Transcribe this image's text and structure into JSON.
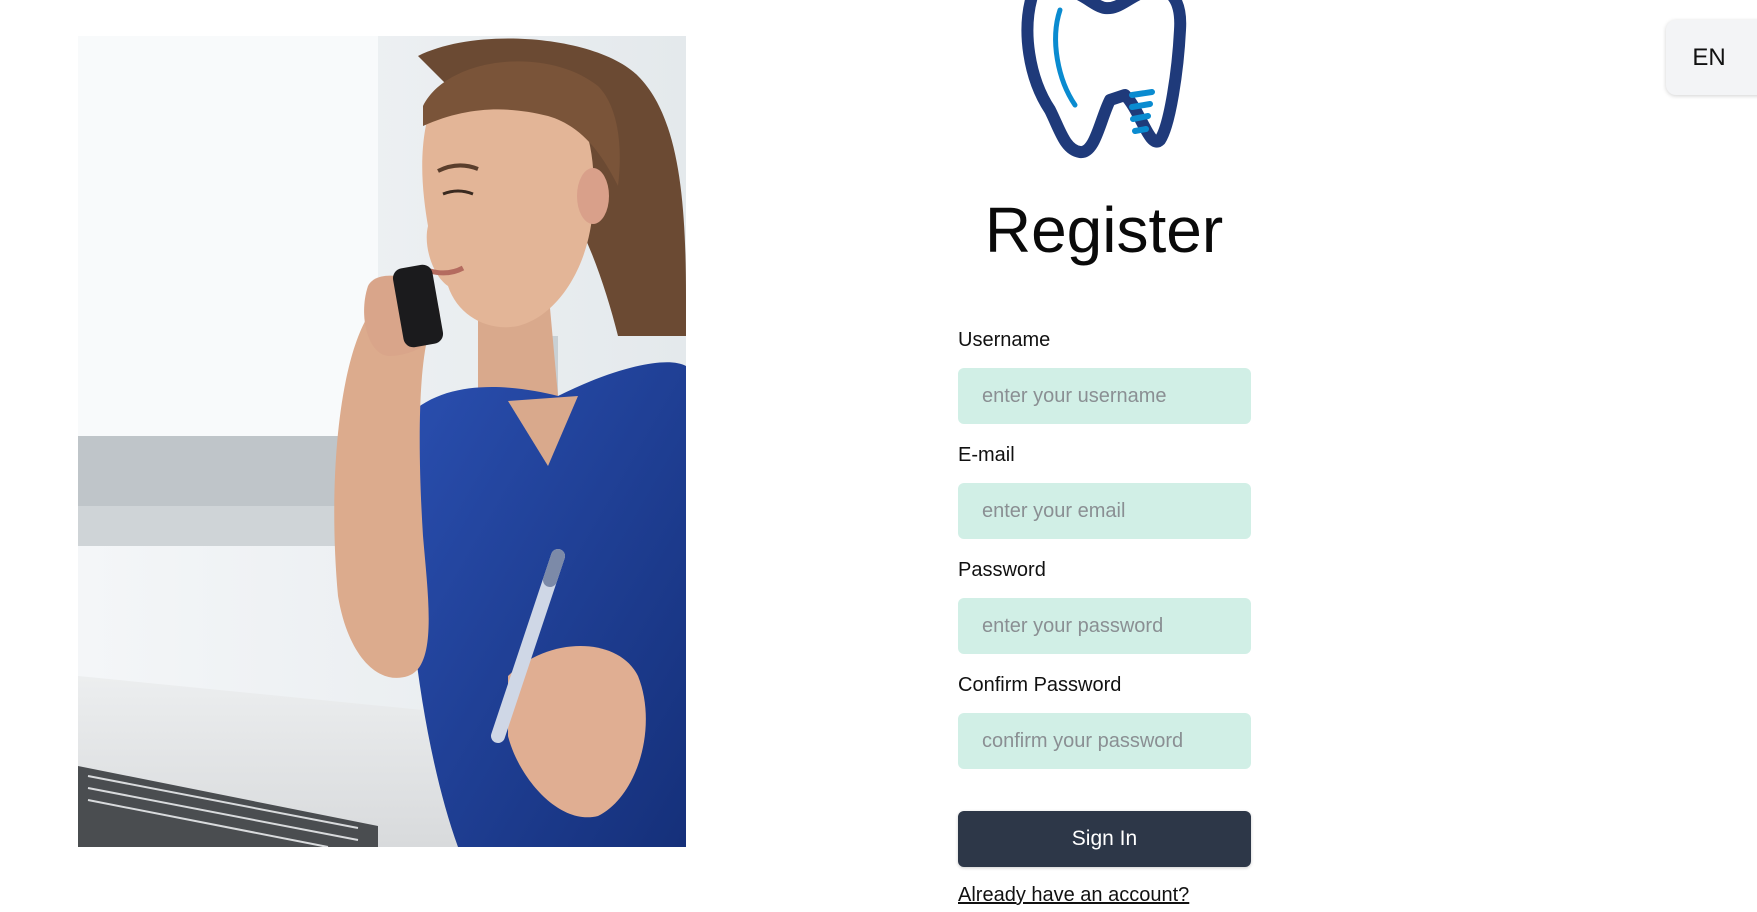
{
  "language": {
    "label": "EN"
  },
  "form": {
    "title": "Register",
    "username": {
      "label": "Username",
      "placeholder": "enter your username"
    },
    "email": {
      "label": "E-mail",
      "placeholder": "enter your email"
    },
    "password": {
      "label": "Password",
      "placeholder": "enter your password"
    },
    "confirm_password": {
      "label": "Confirm Password",
      "placeholder": "confirm your password"
    },
    "submit_label": "Sign In",
    "login_link": "Already have an account?"
  },
  "logo": {
    "icon": "tooth-logo-icon",
    "colors": [
      "#1f3a7a",
      "#0a8bd0"
    ]
  },
  "photo": {
    "icon": "receptionist-photo"
  },
  "colors": {
    "input_bg": "#d1efe6",
    "button_bg": "#2d3748",
    "button_text": "#ffffff"
  }
}
